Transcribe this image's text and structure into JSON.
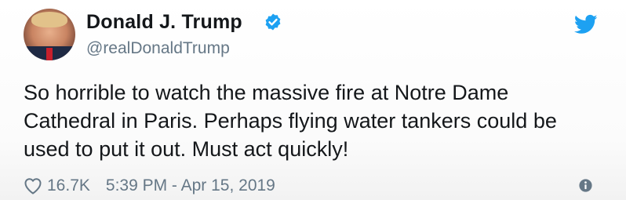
{
  "author": {
    "display_name": "Donald J. Trump",
    "handle": "@realDonaldTrump"
  },
  "tweet": {
    "text": "So horrible to watch the massive fire at Notre Dame Cathedral in Paris. Perhaps flying water tankers could be used to put it out. Must act quickly!",
    "likes": "16.7K",
    "timestamp": "5:39 PM - Apr 15, 2019"
  },
  "icons": {
    "verified": "verified-badge-icon",
    "brand": "twitter-bird-icon",
    "like": "heart-icon",
    "info": "info-icon"
  },
  "colors": {
    "brand_blue": "#1da1f2",
    "text_primary": "#14171a",
    "text_secondary": "#657786"
  }
}
